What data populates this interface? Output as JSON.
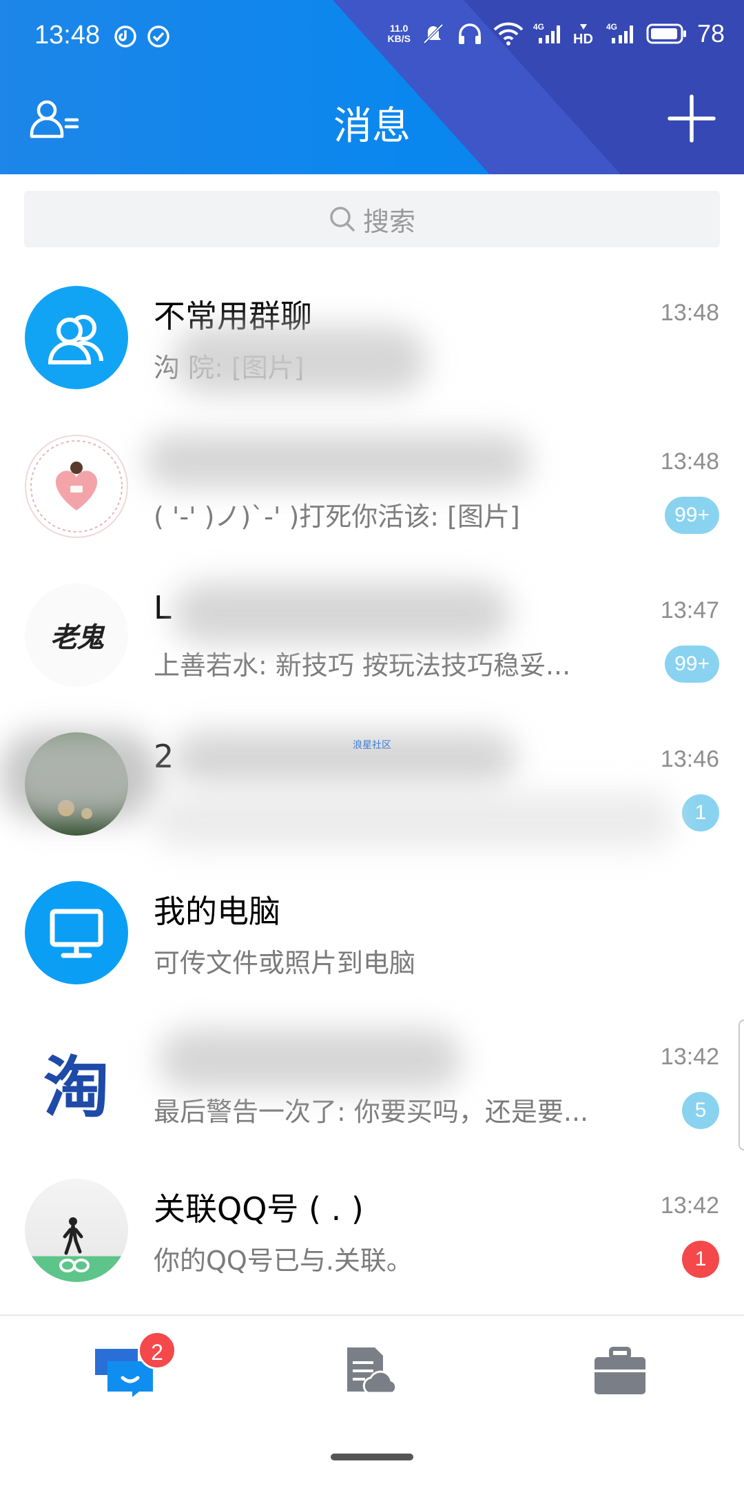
{
  "status_bar": {
    "time": "13:48",
    "net_speed_value": "11.0",
    "net_speed_unit": "KB/S",
    "battery": "78",
    "icons": [
      "sync-icon",
      "check-circle-icon",
      "mute-bell-icon",
      "headphones-icon",
      "wifi-icon",
      "signal-4g-icon",
      "hd-icon",
      "signal-4g-icon",
      "battery-icon"
    ]
  },
  "header": {
    "title": "消息",
    "left_icon": "contacts-icon",
    "right_icon": "plus-icon",
    "colors": {
      "primary": "#0a87ee",
      "accent_dark": "#3548b4"
    }
  },
  "search": {
    "placeholder": "搜索",
    "icon": "search-icon"
  },
  "conversations": [
    {
      "name": "不常用群聊",
      "preview": "沟 院: [图片]",
      "time": "13:48",
      "badge": "",
      "avatar": "group-avatar"
    },
    {
      "name": "",
      "preview": "( '-' )ノ)`-' )打死你活该: [图片]",
      "time": "13:48",
      "badge": "99+",
      "avatar": "love-wall-avatar"
    },
    {
      "name": "L",
      "preview": "上善若水: 新技巧 按玩法技巧稳妥...",
      "time": "13:47",
      "badge": "99+",
      "avatar": "laogui-avatar",
      "avatar_text": "老鬼"
    },
    {
      "name": "2",
      "preview": "",
      "time": "13:46",
      "badge": "1",
      "avatar": "photo-avatar",
      "overlay_text": "浪星社区"
    },
    {
      "name": "我的电脑",
      "preview": "可传文件或照片到电脑",
      "time": "",
      "badge": "",
      "avatar": "computer-avatar"
    },
    {
      "name": "",
      "preview": "最后警告一次了: 你要买吗，还是要...",
      "time": "13:42",
      "badge": "5",
      "avatar": "taobao-avatar",
      "avatar_text": "淘"
    },
    {
      "name": "关联QQ号 ( . )",
      "preview": "你的QQ号已与.关联。",
      "time": "13:42",
      "badge": "1",
      "avatar": "linked-qq-avatar"
    }
  ],
  "bottom_nav": {
    "items": [
      {
        "icon": "messages-icon",
        "badge": "2",
        "active": true
      },
      {
        "icon": "cloud-docs-icon",
        "badge": ""
      },
      {
        "icon": "briefcase-icon",
        "badge": ""
      }
    ]
  }
}
